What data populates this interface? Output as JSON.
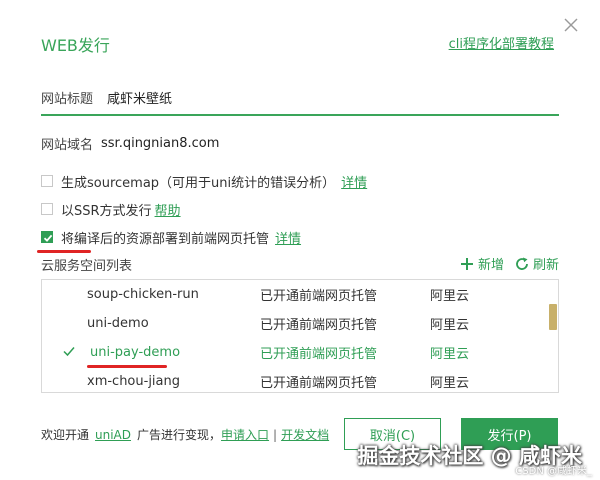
{
  "dialog": {
    "title": "WEB发行",
    "cli_link": "cli程序化部署教程"
  },
  "site_title": {
    "label": "网站标题",
    "value": "咸虾米壁纸"
  },
  "site_domain": {
    "label": "网站域名",
    "value": "ssr.qingnian8.com"
  },
  "options": [
    {
      "label": "生成sourcemap（可用于uni统计的错误分析）",
      "link": "详情",
      "checked": false
    },
    {
      "label": "以SSR方式发行",
      "link": "帮助",
      "checked": false
    },
    {
      "label": "将编译后的资源部署到前端网页托管",
      "link": "详情",
      "checked": true
    }
  ],
  "cloud": {
    "section_title": "云服务空间列表",
    "add_label": "新增",
    "refresh_label": "刷新",
    "rows": [
      {
        "name": "soup-chicken-run",
        "status": "已开通前端网页托管",
        "provider": "阿里云",
        "selected": false
      },
      {
        "name": "uni-demo",
        "status": "已开通前端网页托管",
        "provider": "阿里云",
        "selected": false
      },
      {
        "name": "uni-pay-demo",
        "status": "已开通前端网页托管",
        "provider": "阿里云",
        "selected": true
      },
      {
        "name": "xm-chou-jiang",
        "status": "已开通前端网页托管",
        "provider": "阿里云",
        "selected": false
      }
    ]
  },
  "footer": {
    "prefix": "欢迎开通",
    "uniad": "uniAD",
    "middle": "广告进行变现，",
    "apply": "申请入口",
    "separator": "|",
    "docs": "开发文档"
  },
  "buttons": {
    "cancel": "取消(C)",
    "publish": "发行(P)"
  },
  "watermark": "掘金技术社区 @ 咸虾米",
  "csdn_watermark": "CSDN @咸虾米_",
  "colors": {
    "accent": "#2f9e55",
    "title_green": "#3aa55a",
    "marker_red": "#e02424"
  }
}
